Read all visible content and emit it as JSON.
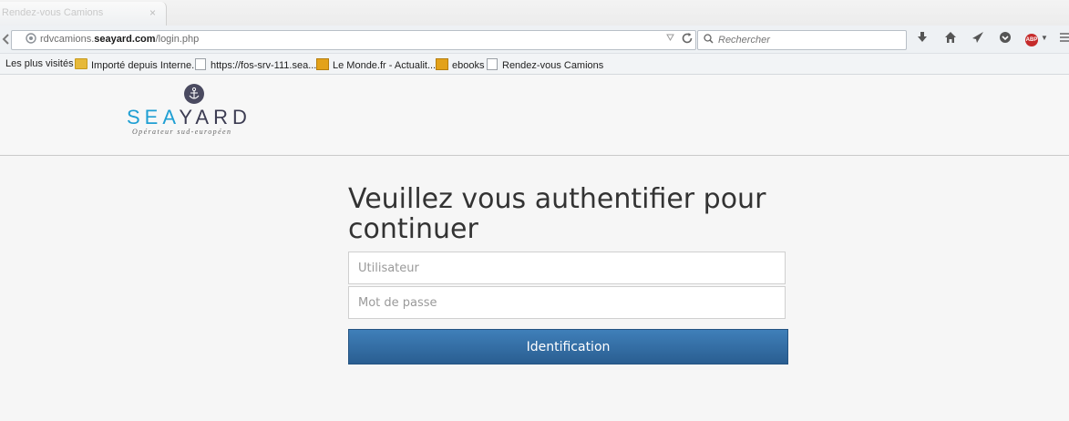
{
  "browser": {
    "tab": {
      "title": "Rendez-vous Camions",
      "close_glyph": "×"
    },
    "url": {
      "prefix": "rdvcamions.",
      "domain": "seayard.com",
      "path": "/login.php"
    },
    "search": {
      "placeholder": "Rechercher"
    },
    "bookmarks": [
      {
        "label": "Les plus visités",
        "icon": "none"
      },
      {
        "label": "Importé depuis Interne...",
        "icon": "folder-icon"
      },
      {
        "label": "https://fos-srv-111.sea...",
        "icon": "page-icon"
      },
      {
        "label": "Le Monde.fr - Actualit...",
        "icon": "feed-icon"
      },
      {
        "label": "ebooks",
        "icon": "feed-icon"
      },
      {
        "label": "Rendez-vous Camions",
        "icon": "page-icon"
      }
    ],
    "toolbar_icons": [
      "download-icon",
      "home-icon",
      "send-icon",
      "pocket-icon",
      "adblock-icon",
      "menu-icon"
    ]
  },
  "header": {
    "logo_sea": "SEA",
    "logo_yard": "YARD",
    "tagline": "Opérateur sud-européen"
  },
  "login": {
    "title": "Veuillez vous authentifier pour continuer",
    "username_placeholder": "Utilisateur",
    "password_placeholder": "Mot de passe",
    "submit_label": "Identification"
  },
  "colors": {
    "logo_sea": "#1f9fd3",
    "logo_yard": "#3c3c52",
    "button_top": "#3f7fb9",
    "button_bottom": "#2a5e91"
  }
}
